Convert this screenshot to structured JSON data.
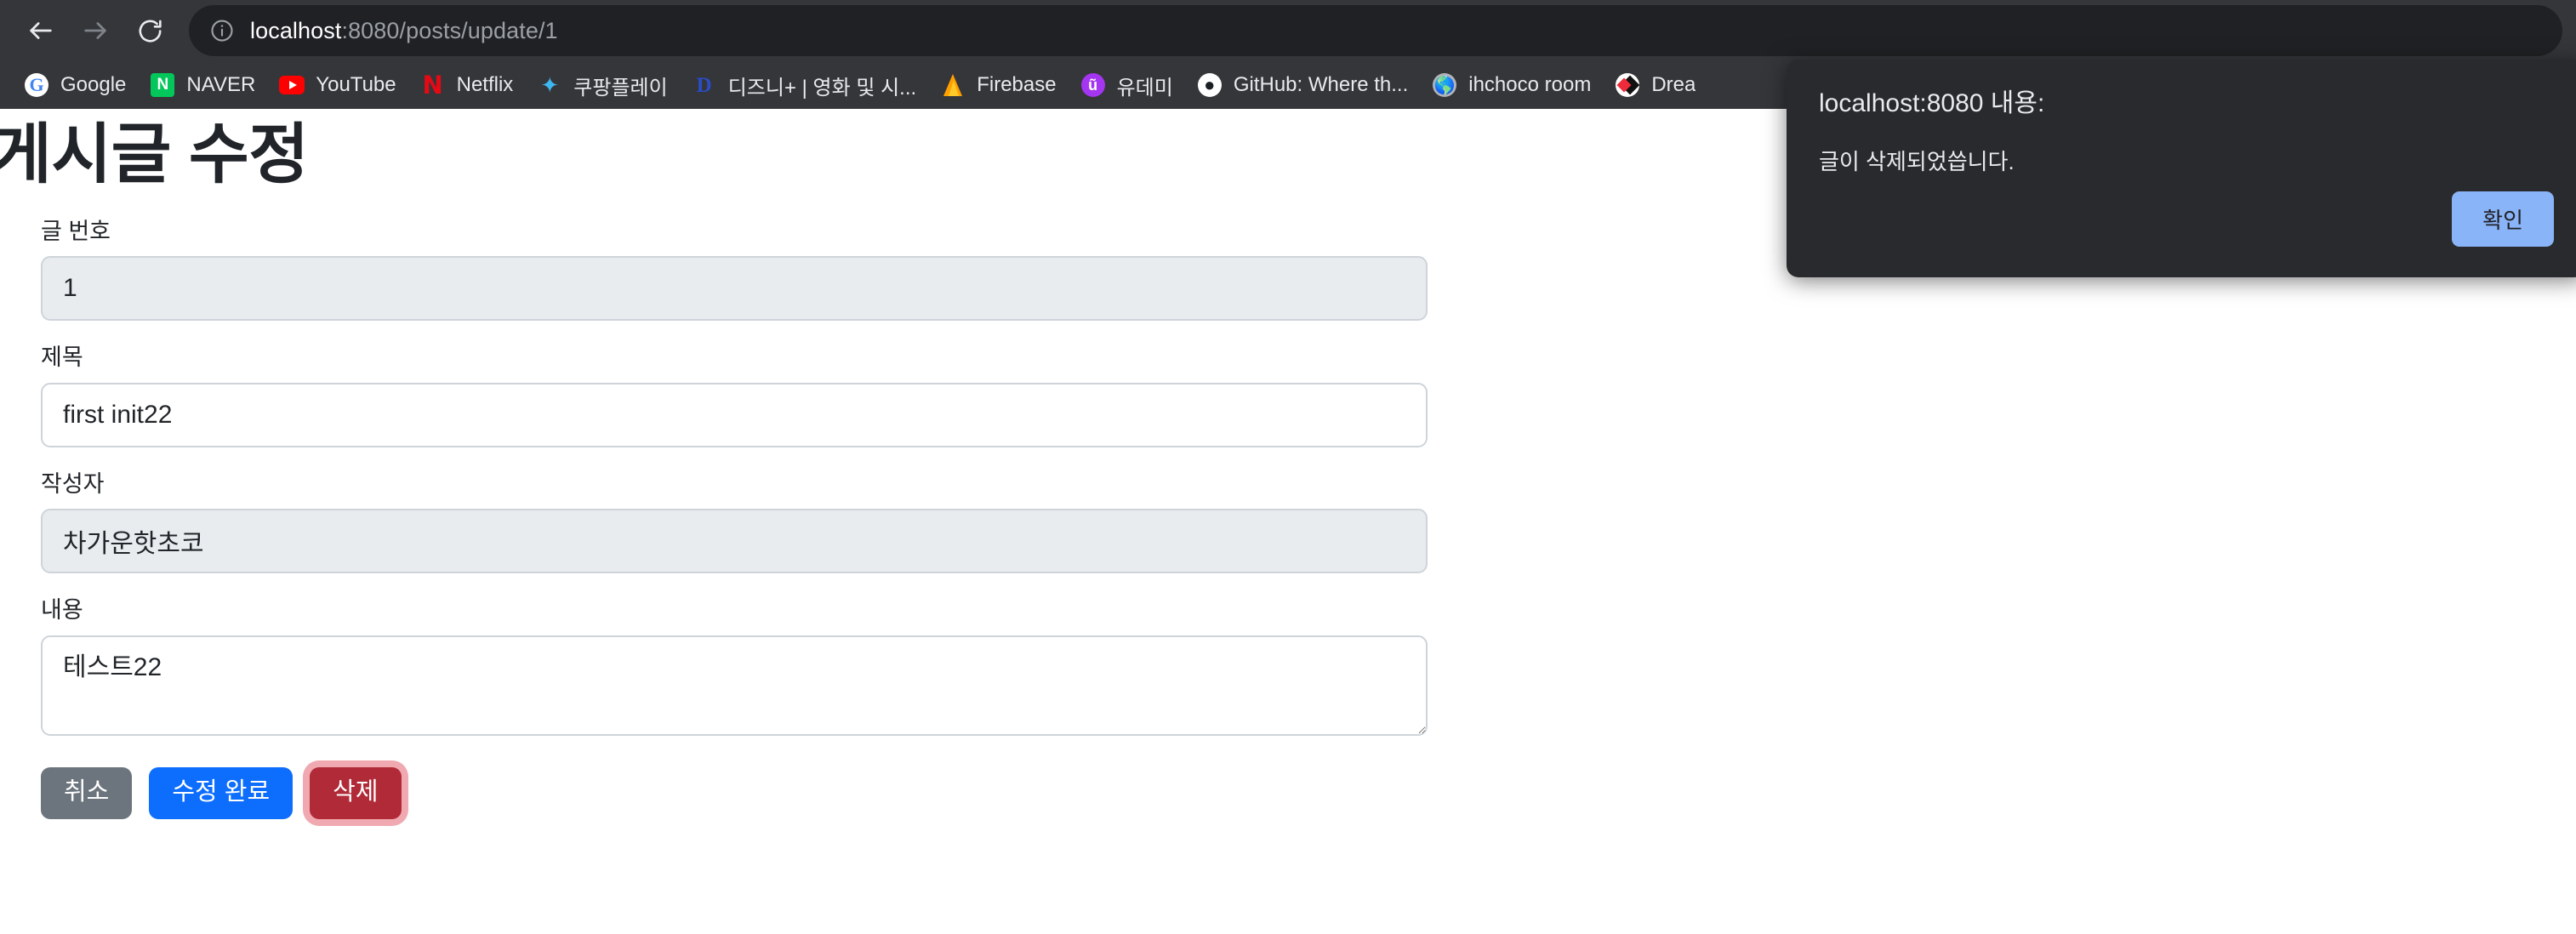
{
  "browser": {
    "nav": {
      "back_icon": "arrow-left-icon",
      "forward_icon": "arrow-right-icon",
      "reload_icon": "reload-icon"
    },
    "omnibox": {
      "site_info_icon": "info-circle-icon",
      "host": "localhost",
      "path": ":8080/posts/update/1",
      "full_url": "localhost:8080/posts/update/1"
    },
    "bookmarks": [
      {
        "label": "Google",
        "icon": "google-favicon"
      },
      {
        "label": "NAVER",
        "icon": "naver-favicon"
      },
      {
        "label": "YouTube",
        "icon": "youtube-favicon"
      },
      {
        "label": "Netflix",
        "icon": "netflix-favicon"
      },
      {
        "label": "쿠팡플레이",
        "icon": "coupang-play-favicon"
      },
      {
        "label": "디즈니+ | 영화 및 시...",
        "icon": "disney-plus-favicon"
      },
      {
        "label": "Firebase",
        "icon": "firebase-favicon"
      },
      {
        "label": "유데미",
        "icon": "udemy-favicon"
      },
      {
        "label": "GitHub: Where th...",
        "icon": "github-favicon"
      },
      {
        "label": "ihchoco room",
        "icon": "globe-favicon"
      },
      {
        "label": "Drea",
        "icon": "dreamhack-favicon"
      }
    ],
    "bookmark_clipped_right": "c"
  },
  "page": {
    "title": "게시글 수정",
    "fields": [
      {
        "label": "글 번호",
        "value": "1",
        "type": "text",
        "readonly": true
      },
      {
        "label": "제목",
        "value": "first init22",
        "type": "text",
        "readonly": false
      },
      {
        "label": "작성자",
        "value": "차가운핫초코",
        "type": "text",
        "readonly": true
      },
      {
        "label": "내용",
        "value": "테스트22",
        "type": "textarea",
        "readonly": false
      }
    ],
    "buttons": {
      "cancel": "취소",
      "submit": "수정 완료",
      "delete": "삭제"
    }
  },
  "dialog": {
    "title": "localhost:8080 내용:",
    "message": "글이 삭제되었씁니다.",
    "ok_label": "확인"
  },
  "colors": {
    "chrome_bg": "#35363a",
    "omnibox_bg": "#202124",
    "dialog_bg": "#292a2d",
    "dialog_ok_bg": "#8ab4f8",
    "btn_secondary": "#6c757d",
    "btn_primary": "#0d6efd",
    "btn_danger": "#b02a37",
    "btn_danger_ring": "rgba(225,83,97,.5)",
    "input_readonly_bg": "#e9ecef",
    "input_border": "#ced4da",
    "text_dark": "#212529"
  }
}
